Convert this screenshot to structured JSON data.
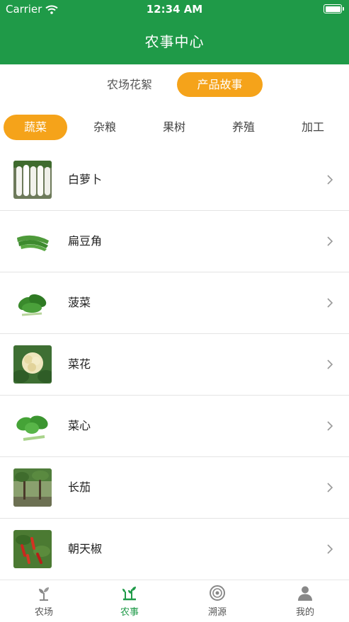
{
  "status_bar": {
    "carrier": "Carrier",
    "time": "12:34 AM"
  },
  "nav": {
    "title": "农事中心"
  },
  "segments": [
    {
      "label": "农场花絮",
      "active": false
    },
    {
      "label": "产品故事",
      "active": true
    }
  ],
  "categories": [
    {
      "label": "蔬菜",
      "active": true
    },
    {
      "label": "杂粮",
      "active": false
    },
    {
      "label": "果树",
      "active": false
    },
    {
      "label": "养殖",
      "active": false
    },
    {
      "label": "加工",
      "active": false
    }
  ],
  "items": [
    {
      "label": "白萝卜",
      "image": "white-radish-photo"
    },
    {
      "label": "扁豆角",
      "image": "flat-bean-photo"
    },
    {
      "label": "菠菜",
      "image": "spinach-photo"
    },
    {
      "label": "菜花",
      "image": "cauliflower-photo"
    },
    {
      "label": "菜心",
      "image": "choy-sum-photo"
    },
    {
      "label": "长茄",
      "image": "long-eggplant-photo"
    },
    {
      "label": "朝天椒",
      "image": "chili-pepper-photo"
    }
  ],
  "tabbar": [
    {
      "label": "农场",
      "icon": "sprout-icon",
      "active": false
    },
    {
      "label": "农事",
      "icon": "farming-icon",
      "active": true
    },
    {
      "label": "溯源",
      "icon": "trace-icon",
      "active": false
    },
    {
      "label": "我的",
      "icon": "user-icon",
      "active": false
    }
  ],
  "colors": {
    "brand_green": "#1f9a48",
    "accent_orange": "#f5a31a"
  }
}
